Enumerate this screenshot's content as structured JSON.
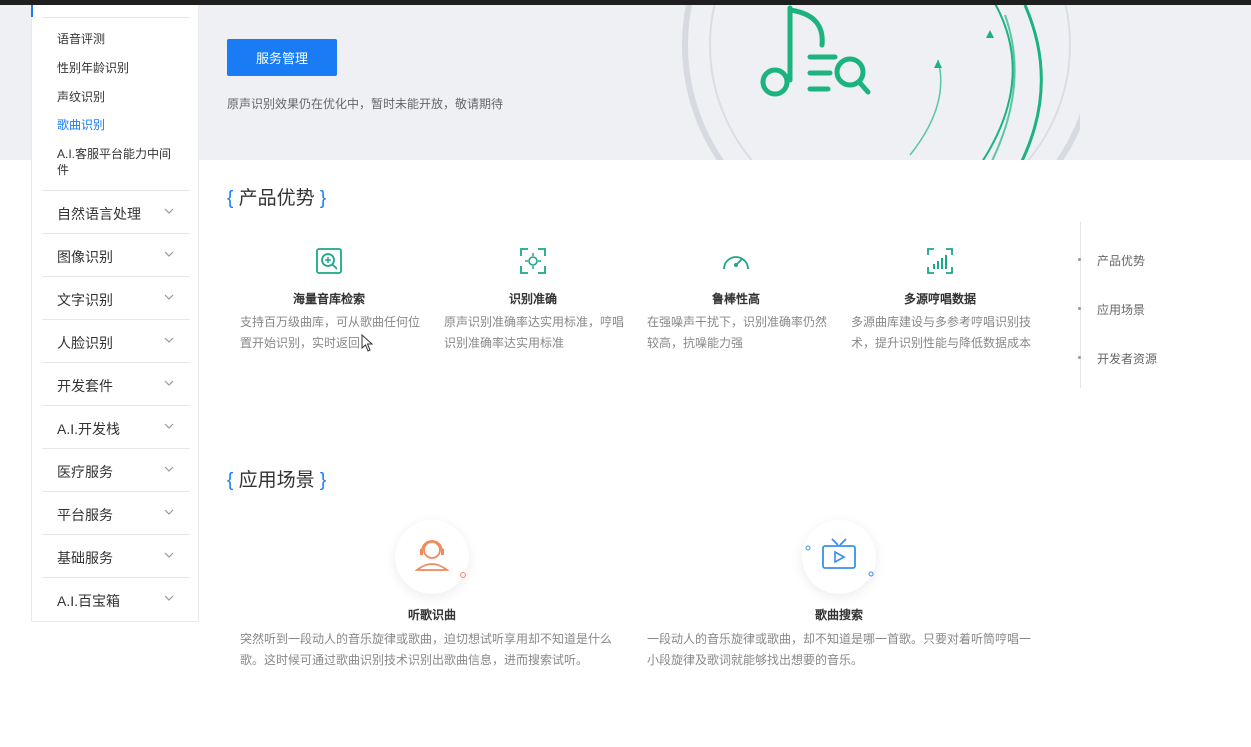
{
  "hero": {
    "button_label": "服务管理",
    "note": "原声识别效果仍在优化中，暂时未能开放，敬请期待",
    "accent_color": "#1a7cf5",
    "art_color": "#1db37f"
  },
  "sidebar": {
    "sub_items": [
      "语音评测",
      "性别年龄识别",
      "声纹识别",
      "歌曲识别",
      "A.I.客服平台能力中间件"
    ],
    "active_sub": "歌曲识别",
    "categories": [
      "自然语言处理",
      "图像识别",
      "文字识别",
      "人脸识别",
      "开发套件",
      "A.I.开发栈",
      "医疗服务",
      "平台服务",
      "基础服务",
      "A.I.百宝箱"
    ]
  },
  "advantages": {
    "title": "产品优势",
    "items": [
      {
        "icon": "search-plus-icon",
        "title": "海量音库检索",
        "desc": "支持百万级曲库，可从歌曲任何位置开始识别，实时返回"
      },
      {
        "icon": "focus-target-icon",
        "title": "识别准确",
        "desc": "原声识别准确率达实用标准，哼唱识别准确率达实用标准"
      },
      {
        "icon": "gauge-icon",
        "title": "鲁棒性高",
        "desc": "在强噪声干扰下，识别准确率仍然较高，抗噪能力强"
      },
      {
        "icon": "bar-chart-icon",
        "title": "多源哼唱数据",
        "desc": "多源曲库建设与多参考哼唱识别技术，提升识别性能与降低数据成本"
      }
    ]
  },
  "right_nav": [
    "产品优势",
    "应用场景",
    "开发者资源"
  ],
  "scenes": {
    "title": "应用场景",
    "items": [
      {
        "icon": "headset-person-icon",
        "title": "听歌识曲",
        "desc": "突然听到一段动人的音乐旋律或歌曲，迫切想试听享用却不知道是什么歌。这时候可通过歌曲识别技术识别出歌曲信息，进而搜索试听。"
      },
      {
        "icon": "tv-play-icon",
        "title": "歌曲搜索",
        "desc": "一段动人的音乐旋律或歌曲，却不知道是哪一首歌。只要对着听筒哼唱一小段旋律及歌词就能够找出想要的音乐。"
      }
    ]
  }
}
